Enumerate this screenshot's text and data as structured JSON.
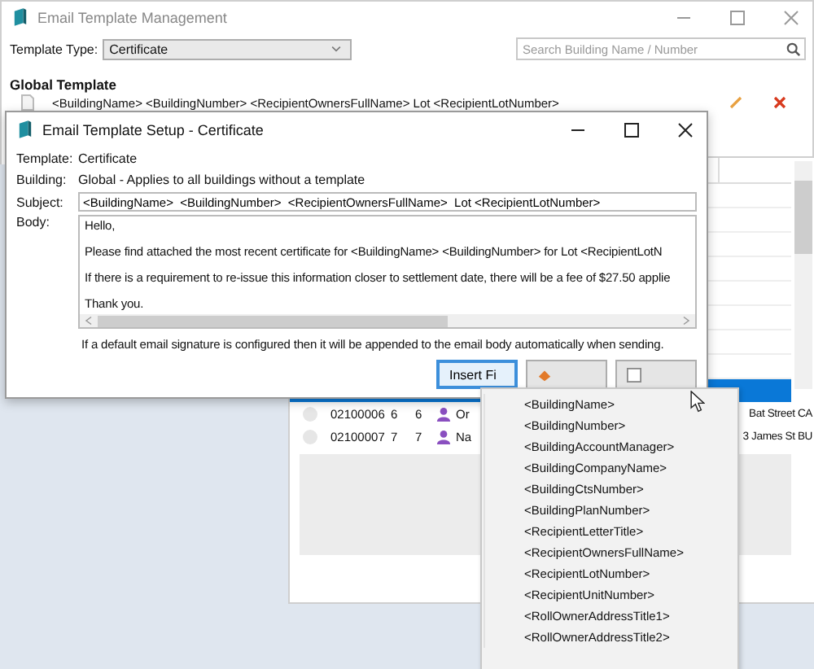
{
  "main_window": {
    "title": "Email Template Management",
    "template_type": {
      "label": "Template Type:",
      "value": "Certificate"
    },
    "search": {
      "placeholder": "Search Building Name / Number"
    },
    "global_template": {
      "heading": "Global Template",
      "subject": "<BuildingName>  <BuildingNumber>  <RecipientOwnersFullName>  Lot <RecipientLotNumber>"
    },
    "grid": {
      "rows": [
        {
          "selected": true
        },
        {
          "selected": false,
          "column_1": "02100006",
          "column_2": "6",
          "column_3": "6",
          "column_4": "Or",
          "column_5": "Bat Street CA"
        },
        {
          "selected": false,
          "column_1": "02100007",
          "column_2": "7",
          "column_3": "7",
          "column_4": "Na",
          "column_5": "3 James St BU"
        }
      ]
    }
  },
  "dialog": {
    "title": "Email Template Setup - Certificate",
    "fields": [
      {
        "label": "Template:",
        "value": "Certificate"
      },
      {
        "label": "Building:",
        "value": "Global - Applies to all buildings without a template"
      }
    ],
    "subject": {
      "label": "Subject:",
      "value": "<BuildingName>  <BuildingNumber>  <RecipientOwnersFullName>  Lot <RecipientLotNumber>"
    },
    "body": {
      "label": "Body:",
      "lines": [
        "Hello,",
        "Please find attached the most recent certificate for <BuildingName>  <BuildingNumber>  for Lot <RecipientLotN",
        "If there is a requirement to re-issue this information closer to settlement date, there will be a fee of $27.50 applie",
        "Thank you."
      ]
    },
    "note": "If a default email signature is configured then it will be appended to the email body automatically when sending.",
    "buttons": [
      {
        "kind": "insert",
        "label": "Insert Fi",
        "focused": true
      },
      {
        "kind": "cancel",
        "focused": false
      },
      {
        "kind": "save",
        "focused": false
      }
    ]
  },
  "field_menu": {
    "items": [
      "<BuildingName>",
      "<BuildingNumber>",
      "<BuildingAccountManager>",
      "<BuildingCompanyName>",
      "<BuildingCtsNumber>",
      "<BuildingPlanNumber>",
      "<RecipientLetterTitle>",
      "<RecipientOwnersFullName>",
      "<RecipientLotNumber>",
      "<RecipientUnitNumber>",
      "<RollOwnerAddressTitle1>",
      "<RollOwnerAddressTitle2>"
    ]
  }
}
